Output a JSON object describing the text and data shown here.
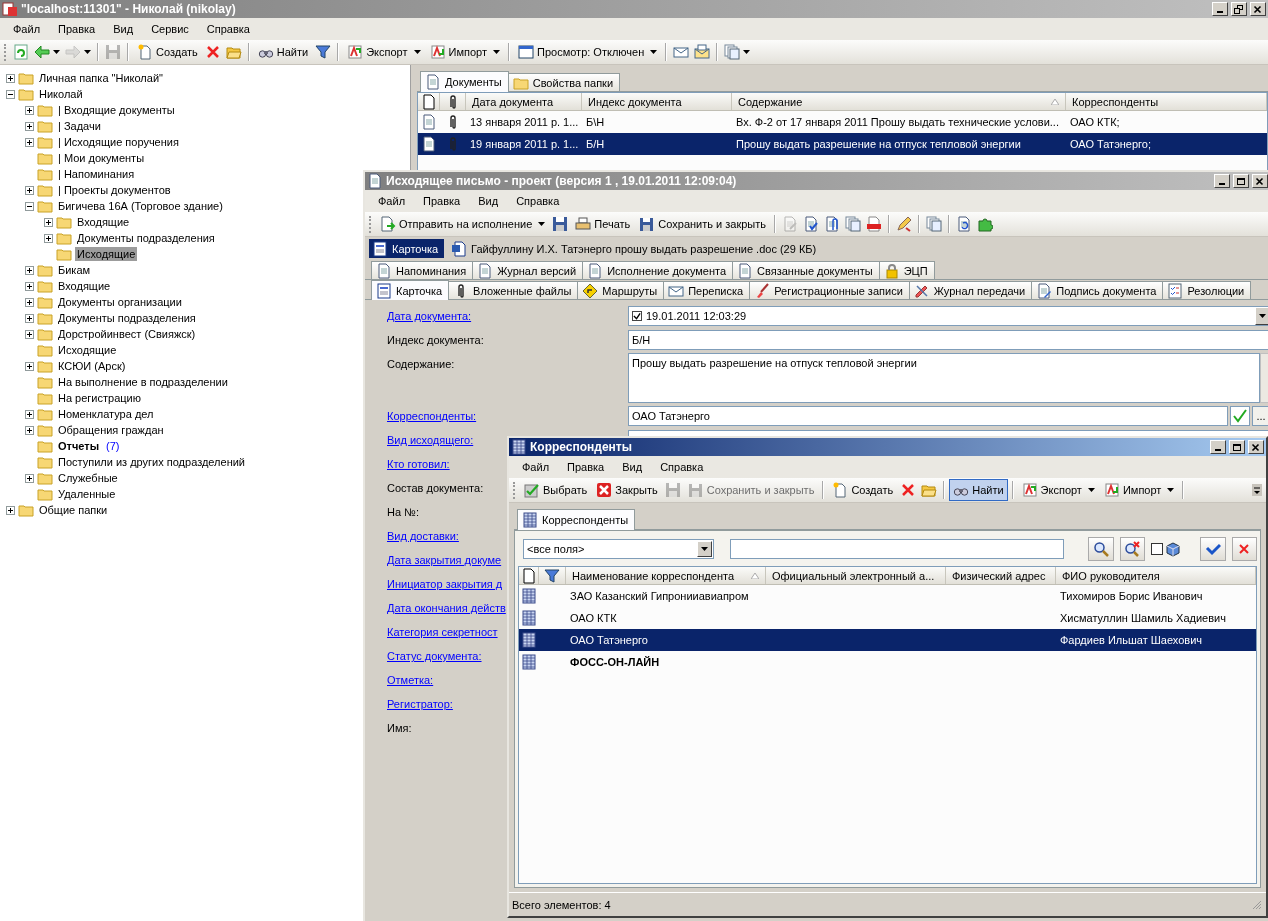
{
  "main": {
    "title": "\"localhost:11301\" - Николай (nikolay)",
    "menu": [
      "Файл",
      "Правка",
      "Вид",
      "Сервис",
      "Справка"
    ],
    "toolbar": [
      {
        "kind": "icon",
        "disabled": false
      },
      {
        "kind": "icon",
        "dropdown": true,
        "disabled": false
      },
      {
        "kind": "icon",
        "dropdown": true,
        "disabled": true
      },
      {
        "kind": "separator"
      },
      {
        "kind": "icon",
        "disabled": true
      },
      {
        "kind": "separator"
      },
      {
        "kind": "button",
        "label": "Создать",
        "disabled": false
      },
      {
        "kind": "icon",
        "disabled": false
      },
      {
        "kind": "icon",
        "disabled": false
      },
      {
        "kind": "separator"
      },
      {
        "kind": "button",
        "label": "Найти",
        "disabled": false
      },
      {
        "kind": "icon",
        "disabled": false
      },
      {
        "kind": "separator"
      },
      {
        "kind": "button",
        "label": "Экспорт",
        "dropdown": true,
        "disabled": false
      },
      {
        "kind": "button",
        "label": "Импорт",
        "dropdown": true,
        "disabled": false
      },
      {
        "kind": "separator"
      },
      {
        "kind": "button",
        "label": "Просмотр: Отключен",
        "dropdown": true,
        "disabled": false
      },
      {
        "kind": "separator"
      },
      {
        "kind": "icon",
        "disabled": false
      },
      {
        "kind": "icon",
        "disabled": false
      },
      {
        "kind": "separator"
      },
      {
        "kind": "icon",
        "dropdown": true,
        "disabled": false
      }
    ],
    "tree": [
      {
        "label": "Личная папка \"Николай\"",
        "expanded": false,
        "selected": false
      },
      {
        "label": "Николай",
        "expanded": true,
        "selected": false,
        "children": [
          {
            "label": "| Входящие документы",
            "expanded": false,
            "selected": false
          },
          {
            "label": "| Задачи",
            "expanded": false,
            "selected": false
          },
          {
            "label": "| Исходящие поручения",
            "expanded": false,
            "selected": false
          },
          {
            "label": "| Мои документы",
            "selected": false
          },
          {
            "label": "| Напоминания",
            "selected": false
          },
          {
            "label": "| Проекты документов",
            "expanded": false,
            "selected": false
          },
          {
            "label": "Бигичева 16А (Торговое здание)",
            "expanded": true,
            "selected": false,
            "children": [
              {
                "label": "Входящие",
                "expanded": false,
                "selected": false
              },
              {
                "label": "Документы подразделения",
                "expanded": false,
                "selected": false
              },
              {
                "label": "Исходящие",
                "selected": true
              }
            ]
          },
          {
            "label": "Бикам",
            "expanded": false,
            "selected": false
          },
          {
            "label": "Входящие",
            "expanded": false,
            "selected": false
          },
          {
            "label": "Документы организации",
            "expanded": false,
            "selected": false
          },
          {
            "label": "Документы подразделения",
            "expanded": false,
            "selected": false
          },
          {
            "label": "Дорстройинвест (Свияжск)",
            "expanded": false,
            "selected": false
          },
          {
            "label": "Исходящие",
            "selected": false
          },
          {
            "label": "КСЮИ (Арск)",
            "expanded": false,
            "selected": false
          },
          {
            "label": "На выполнение в подразделении",
            "selected": false
          },
          {
            "label": "На регистрацию",
            "selected": false
          },
          {
            "label": "Номенклатура дел",
            "expanded": false,
            "selected": false
          },
          {
            "label": "Обращения граждан",
            "expanded": false,
            "selected": false
          },
          {
            "label": "Отчеты",
            "count": "(7)",
            "selected": false
          },
          {
            "label": "Поступили из других подразделений",
            "selected": false
          },
          {
            "label": "Служебные",
            "expanded": false,
            "selected": false
          },
          {
            "label": "Удаленные",
            "selected": false
          }
        ]
      },
      {
        "label": "Общие папки",
        "expanded": false,
        "selected": false
      }
    ],
    "tabs": [
      {
        "label": "Документы",
        "selected": true
      },
      {
        "label": "Свойства папки",
        "selected": false
      }
    ],
    "documents": {
      "columns": [
        {
          "kind": "icon"
        },
        {
          "kind": "icon"
        },
        {
          "kind": "text",
          "label": "Дата документа",
          "sorted": false
        },
        {
          "kind": "text",
          "label": "Индекс документа",
          "sorted": false
        },
        {
          "kind": "text",
          "label": "Содержание",
          "sorted": true
        },
        {
          "kind": "text",
          "label": "Корреспонденты",
          "sorted": false
        }
      ],
      "rows": [
        {
          "cells": [
            "",
            "",
            "13 января 2011 р. 1...",
            "Б\\Н",
            "Вх. Ф-2 от 17 января 2011 Прошу выдать технические услови...",
            "ОАО КТК;"
          ],
          "selected": false
        },
        {
          "cells": [
            "",
            "",
            "19 января 2011 р. 1...",
            "Б/Н",
            "Прошу выдать разрешение на отпуск тепловой энергии",
            "ОАО Татэнерго;"
          ],
          "selected": true
        }
      ]
    }
  },
  "document_window": {
    "title": "Исходящее письмо - проект (версия 1 , 19.01.2011 12:09:04)",
    "menu": [
      "Файл",
      "Правка",
      "Вид",
      "Справка"
    ],
    "toolbar": [
      {
        "kind": "button",
        "label": "Отправить на исполнение",
        "dropdown": true,
        "disabled": false
      },
      {
        "kind": "icon",
        "disabled": false
      },
      {
        "kind": "button",
        "label": "Печать",
        "disabled": false
      },
      {
        "kind": "button",
        "label": "Сохранить и закрыть",
        "disabled": false
      },
      {
        "kind": "separator"
      },
      {
        "kind": "icon",
        "disabled": true
      },
      {
        "kind": "icon",
        "disabled": false
      },
      {
        "kind": "icon",
        "disabled": false
      },
      {
        "kind": "icon",
        "disabled": false
      },
      {
        "kind": "icon",
        "disabled": false
      },
      {
        "kind": "separator"
      },
      {
        "kind": "icon",
        "disabled": false
      },
      {
        "kind": "separator"
      },
      {
        "kind": "icon",
        "disabled": false
      },
      {
        "kind": "separator"
      },
      {
        "kind": "icon",
        "disabled": false
      },
      {
        "kind": "icon",
        "disabled": false
      }
    ],
    "attachments": [
      {
        "label": "Карточка",
        "selected": true
      },
      {
        "label": "Гайфуллину И.Х. Татэнерго прошу выдать разрешение .doc (29 КБ)",
        "selected": false
      }
    ],
    "tabs_row_1": [
      {
        "label": "Напоминания",
        "selected": false
      },
      {
        "label": "Журнал версий",
        "selected": false
      },
      {
        "label": "Исполнение документа",
        "selected": false
      },
      {
        "label": "Связанные документы",
        "selected": false
      },
      {
        "label": "ЭЦП",
        "selected": false
      }
    ],
    "tabs_row_2": [
      {
        "label": "Карточка",
        "selected": true
      },
      {
        "label": "Вложенные файлы",
        "selected": false
      },
      {
        "label": "Маршруты",
        "selected": false
      },
      {
        "label": "Переписка",
        "selected": false
      },
      {
        "label": "Регистрационные записи",
        "selected": false
      },
      {
        "label": "Журнал передачи",
        "selected": false
      },
      {
        "label": "Подпись документа",
        "selected": false
      },
      {
        "label": "Резолюции",
        "selected": false
      }
    ],
    "fields": [
      {
        "label": "Дата документа:",
        "link": true,
        "kind": "date",
        "checked": true,
        "value": "19.01.2011 12:03:29"
      },
      {
        "label": "Индекс документа:",
        "link": false,
        "kind": "text",
        "value": "Б/Н"
      },
      {
        "label": "Содержание:",
        "link": false,
        "kind": "memo",
        "value": "Прошу выдать разрешение на отпуск тепловой энергии"
      },
      {
        "label": "Корреспонденты:",
        "link": true,
        "kind": "lookup",
        "value": "ОАО Татэнерго",
        "button_label": "..."
      },
      {
        "label": "Вид исходящего:",
        "link": true,
        "kind": "text"
      },
      {
        "label": "Кто готовил:",
        "link": true,
        "kind": "none"
      },
      {
        "label": "Состав документа:",
        "link": false,
        "kind": "none"
      },
      {
        "label": "На №:",
        "link": false,
        "kind": "none"
      },
      {
        "label": "Вид доставки:",
        "link": true,
        "kind": "none"
      },
      {
        "label": "Дата закрытия докуме",
        "link": true,
        "kind": "none"
      },
      {
        "label": "Инициатор закрытия д",
        "link": true,
        "kind": "none"
      },
      {
        "label": "Дата окончания действ",
        "link": true,
        "kind": "none"
      },
      {
        "label": "Категория секретност",
        "link": true,
        "kind": "none"
      },
      {
        "label": "Статус документа:",
        "link": true,
        "kind": "none"
      },
      {
        "label": "Отметка:",
        "link": true,
        "kind": "none"
      },
      {
        "label": "Регистратор:",
        "link": true,
        "kind": "none"
      },
      {
        "label": "Имя:",
        "link": false,
        "kind": "none"
      }
    ]
  },
  "dialog": {
    "title": "Корреспонденты",
    "menu": [
      "Файл",
      "Правка",
      "Вид",
      "Справка"
    ],
    "toolbar": [
      {
        "kind": "button",
        "label": "Выбрать",
        "disabled": false,
        "pressed": false
      },
      {
        "kind": "button",
        "label": "Закрыть",
        "disabled": false,
        "pressed": false
      },
      {
        "kind": "icon",
        "disabled": true
      },
      {
        "kind": "button",
        "label": "Сохранить и закрыть",
        "disabled": true,
        "pressed": false
      },
      {
        "kind": "separator"
      },
      {
        "kind": "button",
        "label": "Создать",
        "disabled": false,
        "pressed": false
      },
      {
        "kind": "icon",
        "disabled": false
      },
      {
        "kind": "icon",
        "disabled": false
      },
      {
        "kind": "separator"
      },
      {
        "kind": "button",
        "label": "Найти",
        "disabled": false,
        "pressed": true
      },
      {
        "kind": "separator"
      },
      {
        "kind": "button",
        "label": "Экспорт",
        "dropdown": true,
        "disabled": false,
        "pressed": false
      },
      {
        "kind": "button",
        "label": "Импорт",
        "dropdown": true,
        "disabled": false,
        "pressed": false
      },
      {
        "kind": "separator"
      }
    ],
    "tabs": [
      {
        "label": "Корреспонденты",
        "selected": true
      }
    ],
    "filter": {
      "field": "<все поля>",
      "checked": false
    },
    "table": {
      "columns": [
        {
          "kind": "icon"
        },
        {
          "kind": "icon"
        },
        {
          "kind": "text",
          "label": "Наименование корреспондента",
          "sorted": true
        },
        {
          "kind": "text",
          "label": "Официальный электронный а...",
          "sorted": false
        },
        {
          "kind": "text",
          "label": "Физический адрес",
          "sorted": false
        },
        {
          "kind": "text",
          "label": "ФИО руководителя",
          "sorted": false
        }
      ],
      "rows": [
        {
          "cells": [
            "",
            "",
            "ЗАО Казанский Гипронииавиапром",
            "",
            "",
            "Тихомиров Борис Иванович"
          ],
          "selected": false,
          "bold": false
        },
        {
          "cells": [
            "",
            "",
            "ОАО КТК",
            "",
            "",
            "Хисматуллин Шамиль Хадиевич"
          ],
          "selected": false,
          "bold": false
        },
        {
          "cells": [
            "",
            "",
            "ОАО Татэнерго",
            "",
            "",
            "Фардиев Ильшат Шаехович"
          ],
          "selected": true,
          "bold": false
        },
        {
          "cells": [
            "",
            "",
            "ФОСС-ОН-ЛАЙН",
            "",
            "",
            ""
          ],
          "selected": false,
          "bold": true
        }
      ]
    },
    "status": "Всего элементов: 4"
  }
}
